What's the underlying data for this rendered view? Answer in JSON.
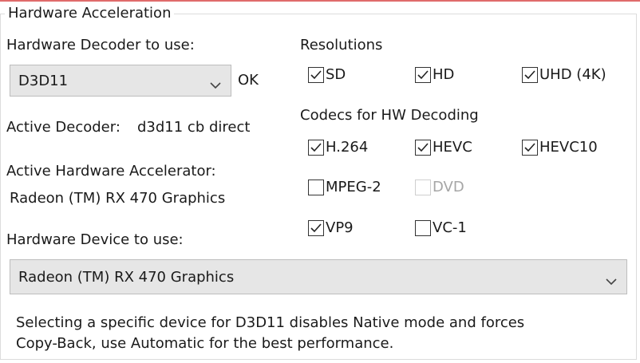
{
  "group": {
    "title": "Hardware Acceleration"
  },
  "decoder": {
    "label": "Hardware Decoder to use:",
    "selected": "D3D11",
    "status": "OK",
    "active_label": "Active Decoder:",
    "active_value": "d3d11 cb direct"
  },
  "accelerator": {
    "label": "Active Hardware Accelerator:",
    "value": "Radeon (TM) RX 470 Graphics"
  },
  "device": {
    "label": "Hardware Device to use:",
    "selected": "Radeon (TM) RX 470 Graphics"
  },
  "note": {
    "line1": "Selecting a specific device for D3D11 disables Native mode and forces",
    "line2": "Copy-Back, use Automatic for the best performance."
  },
  "resolutions": {
    "label": "Resolutions",
    "items": [
      {
        "label": "SD",
        "checked": true,
        "enabled": true
      },
      {
        "label": "HD",
        "checked": true,
        "enabled": true
      },
      {
        "label": "UHD (4K)",
        "checked": true,
        "enabled": true
      }
    ]
  },
  "codecs": {
    "label": "Codecs for HW Decoding",
    "items": [
      {
        "label": "H.264",
        "checked": true,
        "enabled": true
      },
      {
        "label": "HEVC",
        "checked": true,
        "enabled": true
      },
      {
        "label": "HEVC10",
        "checked": true,
        "enabled": true
      },
      {
        "label": "MPEG-2",
        "checked": false,
        "enabled": true
      },
      {
        "label": "DVD",
        "checked": false,
        "enabled": false
      },
      {
        "label": "VP9",
        "checked": true,
        "enabled": true
      },
      {
        "label": "VC-1",
        "checked": false,
        "enabled": true
      }
    ]
  },
  "icons": {
    "dropdown": "chevron-down-icon",
    "check": "checkmark-icon"
  },
  "colors": {
    "combo_bg": "#e6e6e6",
    "disabled_text": "#a6a6a6",
    "top_edge": "#e06b6b"
  }
}
